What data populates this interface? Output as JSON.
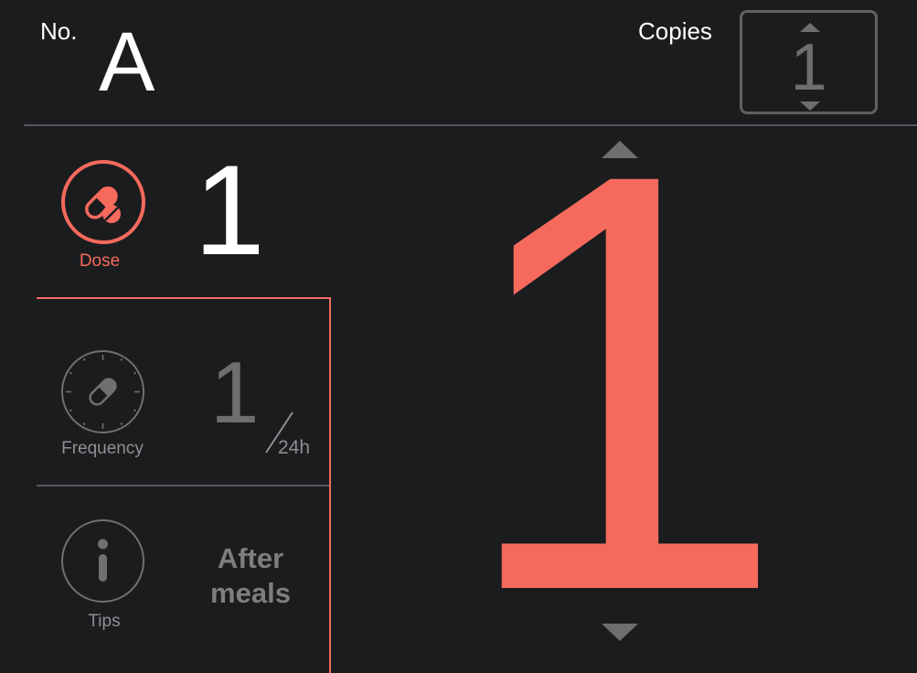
{
  "header": {
    "no_label": "No.",
    "no_value": "A",
    "copies_label": "Copies",
    "copies_value": "1"
  },
  "dose": {
    "label": "Dose",
    "value": "1",
    "icon": "pill-capsule-icon"
  },
  "frequency": {
    "label": "Frequency",
    "value": "1",
    "unit": "24h",
    "icon": "clock-pill-icon"
  },
  "tips": {
    "label": "Tips",
    "text_line1": "After",
    "text_line2": "meals",
    "icon": "info-icon"
  },
  "main": {
    "big_value": "1"
  },
  "colors": {
    "background": "#1b1c1e",
    "accent": "#f56a5d",
    "muted": "#6c6e70",
    "text": "#ffffff"
  }
}
